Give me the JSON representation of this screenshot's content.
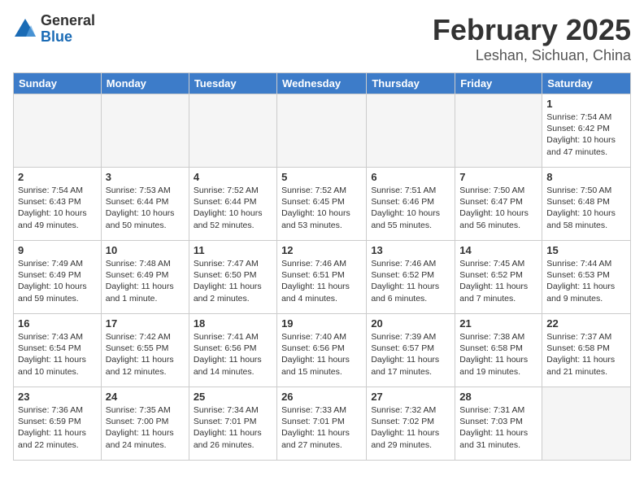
{
  "logo": {
    "general": "General",
    "blue": "Blue"
  },
  "title": {
    "month_year": "February 2025",
    "location": "Leshan, Sichuan, China"
  },
  "weekdays": [
    "Sunday",
    "Monday",
    "Tuesday",
    "Wednesday",
    "Thursday",
    "Friday",
    "Saturday"
  ],
  "weeks": [
    [
      {
        "day": "",
        "info": ""
      },
      {
        "day": "",
        "info": ""
      },
      {
        "day": "",
        "info": ""
      },
      {
        "day": "",
        "info": ""
      },
      {
        "day": "",
        "info": ""
      },
      {
        "day": "",
        "info": ""
      },
      {
        "day": "1",
        "info": "Sunrise: 7:54 AM\nSunset: 6:42 PM\nDaylight: 10 hours and 47 minutes."
      }
    ],
    [
      {
        "day": "2",
        "info": "Sunrise: 7:54 AM\nSunset: 6:43 PM\nDaylight: 10 hours and 49 minutes."
      },
      {
        "day": "3",
        "info": "Sunrise: 7:53 AM\nSunset: 6:44 PM\nDaylight: 10 hours and 50 minutes."
      },
      {
        "day": "4",
        "info": "Sunrise: 7:52 AM\nSunset: 6:44 PM\nDaylight: 10 hours and 52 minutes."
      },
      {
        "day": "5",
        "info": "Sunrise: 7:52 AM\nSunset: 6:45 PM\nDaylight: 10 hours and 53 minutes."
      },
      {
        "day": "6",
        "info": "Sunrise: 7:51 AM\nSunset: 6:46 PM\nDaylight: 10 hours and 55 minutes."
      },
      {
        "day": "7",
        "info": "Sunrise: 7:50 AM\nSunset: 6:47 PM\nDaylight: 10 hours and 56 minutes."
      },
      {
        "day": "8",
        "info": "Sunrise: 7:50 AM\nSunset: 6:48 PM\nDaylight: 10 hours and 58 minutes."
      }
    ],
    [
      {
        "day": "9",
        "info": "Sunrise: 7:49 AM\nSunset: 6:49 PM\nDaylight: 10 hours and 59 minutes."
      },
      {
        "day": "10",
        "info": "Sunrise: 7:48 AM\nSunset: 6:49 PM\nDaylight: 11 hours and 1 minute."
      },
      {
        "day": "11",
        "info": "Sunrise: 7:47 AM\nSunset: 6:50 PM\nDaylight: 11 hours and 2 minutes."
      },
      {
        "day": "12",
        "info": "Sunrise: 7:46 AM\nSunset: 6:51 PM\nDaylight: 11 hours and 4 minutes."
      },
      {
        "day": "13",
        "info": "Sunrise: 7:46 AM\nSunset: 6:52 PM\nDaylight: 11 hours and 6 minutes."
      },
      {
        "day": "14",
        "info": "Sunrise: 7:45 AM\nSunset: 6:52 PM\nDaylight: 11 hours and 7 minutes."
      },
      {
        "day": "15",
        "info": "Sunrise: 7:44 AM\nSunset: 6:53 PM\nDaylight: 11 hours and 9 minutes."
      }
    ],
    [
      {
        "day": "16",
        "info": "Sunrise: 7:43 AM\nSunset: 6:54 PM\nDaylight: 11 hours and 10 minutes."
      },
      {
        "day": "17",
        "info": "Sunrise: 7:42 AM\nSunset: 6:55 PM\nDaylight: 11 hours and 12 minutes."
      },
      {
        "day": "18",
        "info": "Sunrise: 7:41 AM\nSunset: 6:56 PM\nDaylight: 11 hours and 14 minutes."
      },
      {
        "day": "19",
        "info": "Sunrise: 7:40 AM\nSunset: 6:56 PM\nDaylight: 11 hours and 15 minutes."
      },
      {
        "day": "20",
        "info": "Sunrise: 7:39 AM\nSunset: 6:57 PM\nDaylight: 11 hours and 17 minutes."
      },
      {
        "day": "21",
        "info": "Sunrise: 7:38 AM\nSunset: 6:58 PM\nDaylight: 11 hours and 19 minutes."
      },
      {
        "day": "22",
        "info": "Sunrise: 7:37 AM\nSunset: 6:58 PM\nDaylight: 11 hours and 21 minutes."
      }
    ],
    [
      {
        "day": "23",
        "info": "Sunrise: 7:36 AM\nSunset: 6:59 PM\nDaylight: 11 hours and 22 minutes."
      },
      {
        "day": "24",
        "info": "Sunrise: 7:35 AM\nSunset: 7:00 PM\nDaylight: 11 hours and 24 minutes."
      },
      {
        "day": "25",
        "info": "Sunrise: 7:34 AM\nSunset: 7:01 PM\nDaylight: 11 hours and 26 minutes."
      },
      {
        "day": "26",
        "info": "Sunrise: 7:33 AM\nSunset: 7:01 PM\nDaylight: 11 hours and 27 minutes."
      },
      {
        "day": "27",
        "info": "Sunrise: 7:32 AM\nSunset: 7:02 PM\nDaylight: 11 hours and 29 minutes."
      },
      {
        "day": "28",
        "info": "Sunrise: 7:31 AM\nSunset: 7:03 PM\nDaylight: 11 hours and 31 minutes."
      },
      {
        "day": "",
        "info": ""
      }
    ]
  ]
}
